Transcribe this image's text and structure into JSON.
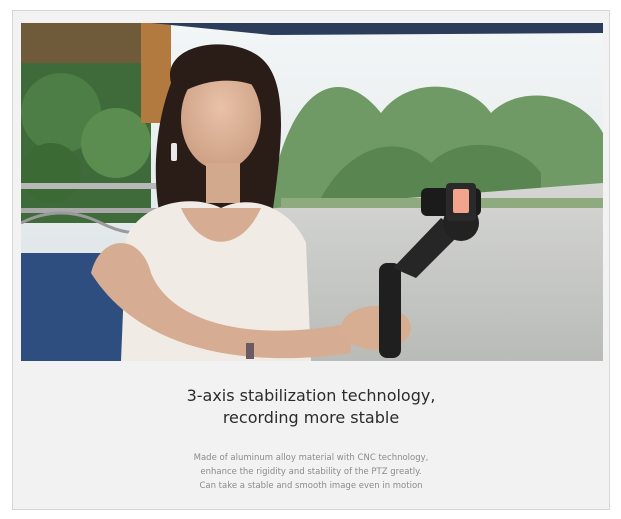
{
  "image": {
    "subject": "Woman holding a handheld 3-axis smartphone gimbal",
    "colors": {
      "sky": "#e6eef0",
      "trees": "#5f8f56",
      "road": "#c7c9c6",
      "dress": "#f1ebe6",
      "hair": "#2a1d18",
      "gimbal": "#1f1f1f"
    }
  },
  "caption": {
    "headline_line1": "3-axis stabilization technology,",
    "headline_line2": "recording more stable",
    "desc_line1": "Made of aluminum alloy material with CNC technology,",
    "desc_line2": "enhance the rigidity and stability of the PTZ greatly.",
    "desc_line3": "Can take a stable and smooth image even in motion"
  }
}
